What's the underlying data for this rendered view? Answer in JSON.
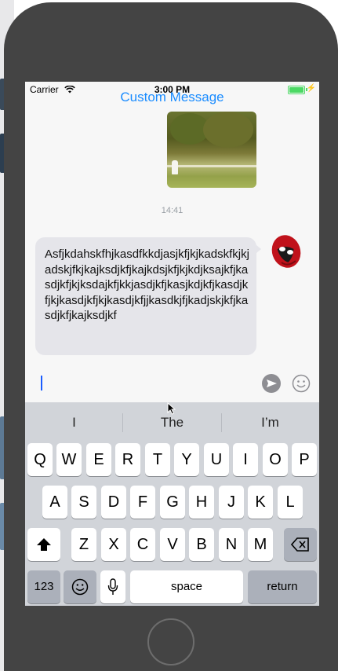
{
  "status_bar": {
    "carrier": "Carrier",
    "time": "3:00 PM"
  },
  "nav": {
    "title": "Custom Message"
  },
  "messages": {
    "timestamp": "14:41",
    "text": "Asfjkdahskfhjkasdfkkdjasjkfjkjkadskfkjkjadskjfkjkajksdjkfjkajkdsjkfjkjkdjksajkfjkasdjkfjkjksdajkfjkkjasdjkfjkasjkdjkfjkasdjkfjkjkasdjkfjkjkasdjkfjjkasdkjfjkadjskjkfjkasdjkfjkajksdjkf"
  },
  "input": {
    "value": ""
  },
  "keyboard": {
    "suggestions": [
      "I",
      "The",
      "I’m"
    ],
    "row1": [
      "Q",
      "W",
      "E",
      "R",
      "T",
      "Y",
      "U",
      "I",
      "O",
      "P"
    ],
    "row2": [
      "A",
      "S",
      "D",
      "F",
      "G",
      "H",
      "J",
      "K",
      "L"
    ],
    "row3": [
      "Z",
      "X",
      "C",
      "V",
      "B",
      "N",
      "M"
    ],
    "numbers_label": "123",
    "space_label": "space",
    "return_label": "return"
  },
  "icons": {
    "wifi": "wifi-icon",
    "battery": "battery-icon",
    "send": "send-icon",
    "emoji": "smiley-icon",
    "shift": "shift-icon",
    "delete": "backspace-icon",
    "emoji_key": "emoji-key-icon",
    "mic": "microphone-icon"
  },
  "colors": {
    "accent": "#1a8cff",
    "bubble": "#e5e5ea",
    "battery": "#4cd964",
    "keyboard_bg": "#d1d4d9"
  }
}
